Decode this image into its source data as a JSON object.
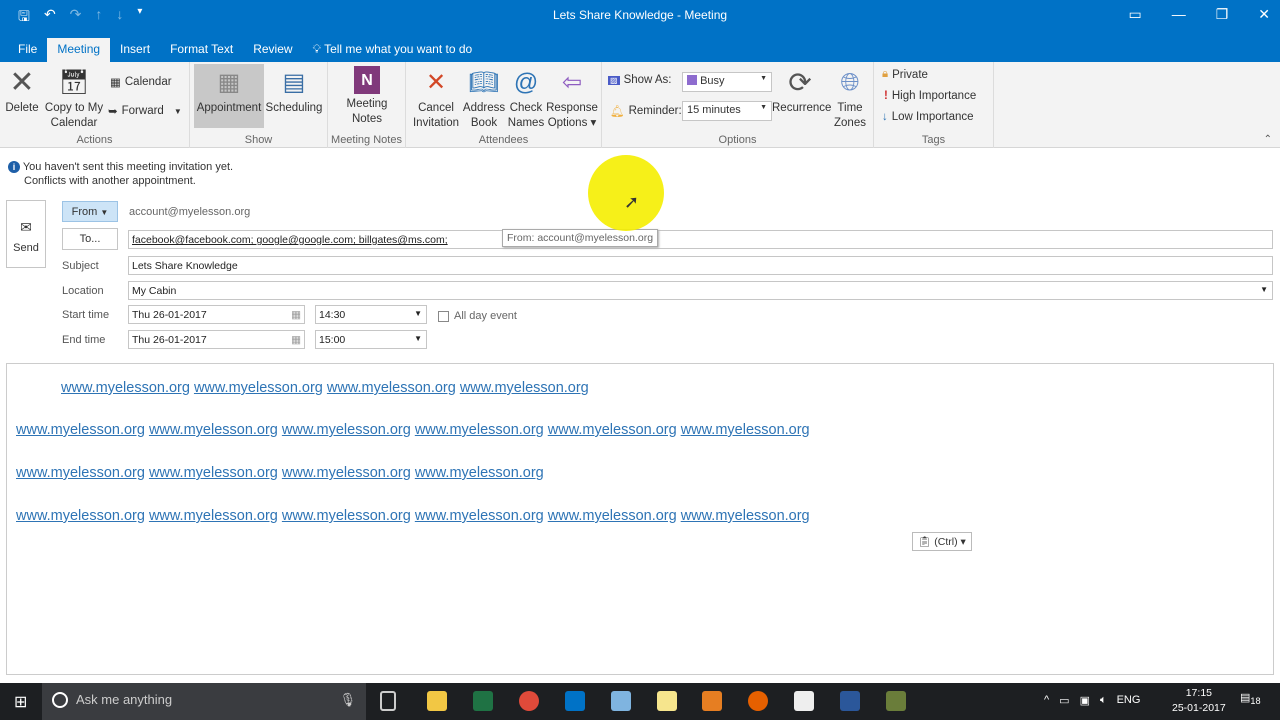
{
  "window": {
    "title": "Lets Share Knowledge  -  Meeting"
  },
  "tabs": [
    "File",
    "Meeting",
    "Insert",
    "Format Text",
    "Review"
  ],
  "tell_me": "Tell me what you want to do",
  "ribbon": {
    "actions": {
      "label": "Actions",
      "delete": "Delete",
      "copy1": "Copy to My",
      "copy2": "Calendar",
      "calendar": "Calendar",
      "forward": "Forward"
    },
    "show": {
      "label": "Show",
      "appointment": "Appointment",
      "scheduling": "Scheduling"
    },
    "meeting_notes": {
      "label": "Meeting Notes",
      "b1": "Meeting",
      "b2": "Notes"
    },
    "attendees": {
      "label": "Attendees",
      "cancel1": "Cancel",
      "cancel2": "Invitation",
      "address1": "Address",
      "address2": "Book",
      "check1": "Check",
      "check2": "Names",
      "resp1": "Response",
      "resp2": "Options"
    },
    "options": {
      "label": "Options",
      "show_as": "Show As:",
      "show_as_value": "Busy",
      "reminder": "Reminder:",
      "reminder_value": "15 minutes",
      "recurrence": "Recurrence",
      "tz1": "Time",
      "tz2": "Zones"
    },
    "tags": {
      "label": "Tags",
      "private": "Private",
      "high": "High Importance",
      "low": "Low Importance"
    }
  },
  "info": {
    "line1": "You haven't sent this meeting invitation yet.",
    "line2": "Conflicts with another appointment."
  },
  "form": {
    "send": "Send",
    "from_btn": "From",
    "from_value": "account@myelesson.org",
    "to_btn": "To...",
    "to_value": "facebook@facebook.com; google@google.com; billgates@ms.com;",
    "tooltip": "From: account@myelesson.org",
    "subject_label": "Subject",
    "subject": "Lets Share Knowledge",
    "location_label": "Location",
    "location": "My Cabin",
    "start_label": "Start time",
    "start_date": "Thu 26-01-2017",
    "start_time": "14:30",
    "all_day": "All day event",
    "end_label": "End time",
    "end_date": "Thu 26-01-2017",
    "end_time": "15:00"
  },
  "body": {
    "link": "www.myelesson.org",
    "lines": [
      4,
      6,
      4,
      6
    ],
    "paste": "(Ctrl)"
  },
  "taskbar": {
    "search": "Ask me anything",
    "lang": "ENG",
    "time": "17:15",
    "date": "25-01-2017",
    "notif": "18"
  },
  "colors": {
    "brand": "#0072c6",
    "link": "#2e74b5"
  }
}
